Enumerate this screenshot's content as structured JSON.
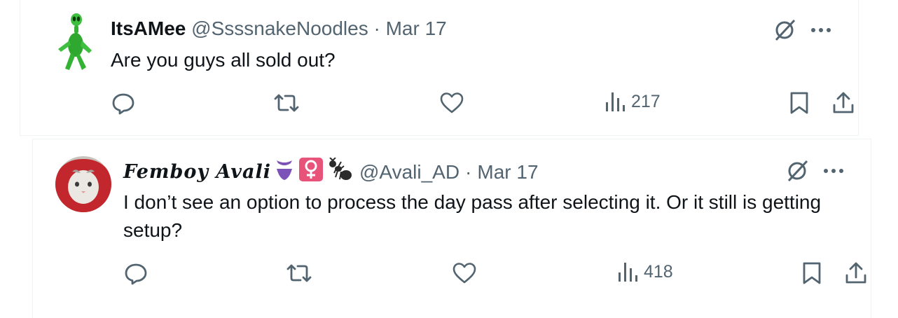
{
  "tweets": [
    {
      "display_name": "ItsAMee",
      "handle": "@SsssnakeNoodles",
      "separator": "·",
      "date": "Mar 17",
      "text": "Are you guys all sold out?",
      "views": "217",
      "avatar_icon": "green-alien-avatar"
    },
    {
      "display_name": "Femboy Avali",
      "handle": "@Avali_AD",
      "separator": "·",
      "date": "Mar 17",
      "text": "I don’t see an option to process the day pass after selecting it. Or it still is getting setup?",
      "views": "418",
      "avatar_icon": "cat-in-red-hood-avatar",
      "name_emojis": [
        "purple-bikini-bottom-emoji",
        "female-sign-emoji",
        "ant-emoji"
      ]
    }
  ],
  "colors": {
    "text": "#0f1419",
    "secondary": "#536471",
    "border": "#eff3f4",
    "female_sign_bg": "#e8537a",
    "bikini": "#7d52b8"
  },
  "icons": [
    "grok-icon",
    "more-icon",
    "reply-icon",
    "retweet-icon",
    "like-icon",
    "views-icon",
    "bookmark-icon",
    "share-icon"
  ]
}
